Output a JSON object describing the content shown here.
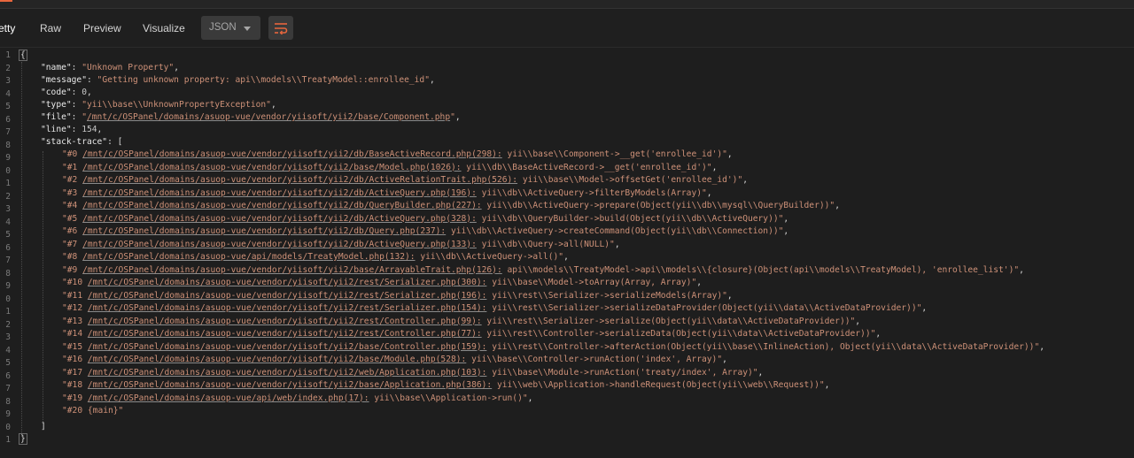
{
  "toolbar": {
    "tabs": [
      {
        "label": "etty"
      },
      {
        "label": "Raw"
      },
      {
        "label": "Preview"
      },
      {
        "label": "Visualize"
      }
    ],
    "format_select": {
      "value": "JSON"
    },
    "wrap_icon": "wrap-lines-icon",
    "accent_color": "#e8663d"
  },
  "editor": {
    "line_numbers": [
      "1",
      "2",
      "3",
      "4",
      "5",
      "6",
      "7",
      "8",
      "9",
      "0",
      "1",
      "2",
      "3",
      "4",
      "5",
      "6",
      "7",
      "8",
      "9",
      "0",
      "1",
      "2",
      "3",
      "4",
      "5",
      "6",
      "7",
      "8",
      "9",
      "0",
      "1"
    ],
    "open_brace": "{",
    "close_brace": "}",
    "fields": {
      "name": {
        "key": "\"name\"",
        "value": "\"Unknown Property\""
      },
      "message": {
        "key": "\"message\"",
        "value": "\"Getting unknown property: api\\\\models\\\\TreatyModel::enrollee_id\""
      },
      "code": {
        "key": "\"code\"",
        "value": "0"
      },
      "type": {
        "key": "\"type\"",
        "value": "\"yii\\\\base\\\\UnknownPropertyException\""
      },
      "file": {
        "key": "\"file\"",
        "prefix": "\"",
        "value": "/mnt/c/OSPanel/domains/asuop-vue/vendor/yiisoft/yii2/base/Component.php",
        "suffix": "\""
      },
      "line": {
        "key": "\"line\"",
        "value": "154"
      },
      "stack_trace_key": "\"stack-trace\""
    },
    "stack_trace": [
      {
        "num": "\"#0 ",
        "path": "/mnt/c/OSPanel/domains/asuop-vue/vendor/yiisoft/yii2/db/BaseActiveRecord.php(298):",
        "call": " yii\\\\base\\\\Component->__get('enrollee_id')\""
      },
      {
        "num": "\"#1 ",
        "path": "/mnt/c/OSPanel/domains/asuop-vue/vendor/yiisoft/yii2/base/Model.php(1026):",
        "call": " yii\\\\db\\\\BaseActiveRecord->__get('enrollee_id')\""
      },
      {
        "num": "\"#2 ",
        "path": "/mnt/c/OSPanel/domains/asuop-vue/vendor/yiisoft/yii2/db/ActiveRelationTrait.php(526):",
        "call": " yii\\\\base\\\\Model->offsetGet('enrollee_id')\""
      },
      {
        "num": "\"#3 ",
        "path": "/mnt/c/OSPanel/domains/asuop-vue/vendor/yiisoft/yii2/db/ActiveQuery.php(196):",
        "call": " yii\\\\db\\\\ActiveQuery->filterByModels(Array)\""
      },
      {
        "num": "\"#4 ",
        "path": "/mnt/c/OSPanel/domains/asuop-vue/vendor/yiisoft/yii2/db/QueryBuilder.php(227):",
        "call": " yii\\\\db\\\\ActiveQuery->prepare(Object(yii\\\\db\\\\mysql\\\\QueryBuilder))\""
      },
      {
        "num": "\"#5 ",
        "path": "/mnt/c/OSPanel/domains/asuop-vue/vendor/yiisoft/yii2/db/ActiveQuery.php(328):",
        "call": " yii\\\\db\\\\QueryBuilder->build(Object(yii\\\\db\\\\ActiveQuery))\""
      },
      {
        "num": "\"#6 ",
        "path": "/mnt/c/OSPanel/domains/asuop-vue/vendor/yiisoft/yii2/db/Query.php(237):",
        "call": " yii\\\\db\\\\ActiveQuery->createCommand(Object(yii\\\\db\\\\Connection))\""
      },
      {
        "num": "\"#7 ",
        "path": "/mnt/c/OSPanel/domains/asuop-vue/vendor/yiisoft/yii2/db/ActiveQuery.php(133):",
        "call": " yii\\\\db\\\\Query->all(NULL)\""
      },
      {
        "num": "\"#8 ",
        "path": "/mnt/c/OSPanel/domains/asuop-vue/api/models/TreatyModel.php(132):",
        "call": " yii\\\\db\\\\ActiveQuery->all()\""
      },
      {
        "num": "\"#9 ",
        "path": "/mnt/c/OSPanel/domains/asuop-vue/vendor/yiisoft/yii2/base/ArrayableTrait.php(126):",
        "call": " api\\\\models\\\\TreatyModel->api\\\\models\\\\{closure}(Object(api\\\\models\\\\TreatyModel), 'enrollee_list')\""
      },
      {
        "num": "\"#10 ",
        "path": "/mnt/c/OSPanel/domains/asuop-vue/vendor/yiisoft/yii2/rest/Serializer.php(300):",
        "call": " yii\\\\base\\\\Model->toArray(Array, Array)\""
      },
      {
        "num": "\"#11 ",
        "path": "/mnt/c/OSPanel/domains/asuop-vue/vendor/yiisoft/yii2/rest/Serializer.php(196):",
        "call": " yii\\\\rest\\\\Serializer->serializeModels(Array)\""
      },
      {
        "num": "\"#12 ",
        "path": "/mnt/c/OSPanel/domains/asuop-vue/vendor/yiisoft/yii2/rest/Serializer.php(154):",
        "call": " yii\\\\rest\\\\Serializer->serializeDataProvider(Object(yii\\\\data\\\\ActiveDataProvider))\""
      },
      {
        "num": "\"#13 ",
        "path": "/mnt/c/OSPanel/domains/asuop-vue/vendor/yiisoft/yii2/rest/Controller.php(99):",
        "call": " yii\\\\rest\\\\Serializer->serialize(Object(yii\\\\data\\\\ActiveDataProvider))\""
      },
      {
        "num": "\"#14 ",
        "path": "/mnt/c/OSPanel/domains/asuop-vue/vendor/yiisoft/yii2/rest/Controller.php(77):",
        "call": " yii\\\\rest\\\\Controller->serializeData(Object(yii\\\\data\\\\ActiveDataProvider))\""
      },
      {
        "num": "\"#15 ",
        "path": "/mnt/c/OSPanel/domains/asuop-vue/vendor/yiisoft/yii2/base/Controller.php(159):",
        "call": " yii\\\\rest\\\\Controller->afterAction(Object(yii\\\\base\\\\InlineAction), Object(yii\\\\data\\\\ActiveDataProvider))\""
      },
      {
        "num": "\"#16 ",
        "path": "/mnt/c/OSPanel/domains/asuop-vue/vendor/yiisoft/yii2/base/Module.php(528):",
        "call": " yii\\\\base\\\\Controller->runAction('index', Array)\""
      },
      {
        "num": "\"#17 ",
        "path": "/mnt/c/OSPanel/domains/asuop-vue/vendor/yiisoft/yii2/web/Application.php(103):",
        "call": " yii\\\\base\\\\Module->runAction('treaty/index', Array)\""
      },
      {
        "num": "\"#18 ",
        "path": "/mnt/c/OSPanel/domains/asuop-vue/vendor/yiisoft/yii2/base/Application.php(386):",
        "call": " yii\\\\web\\\\Application->handleRequest(Object(yii\\\\web\\\\Request))\""
      },
      {
        "num": "\"#19 ",
        "path": "/mnt/c/OSPanel/domains/asuop-vue/api/web/index.php(17):",
        "call": " yii\\\\base\\\\Application->run()\""
      },
      {
        "num": "\"#20 ",
        "path": "",
        "call": "{main}\""
      }
    ],
    "close_bracket": "]"
  }
}
